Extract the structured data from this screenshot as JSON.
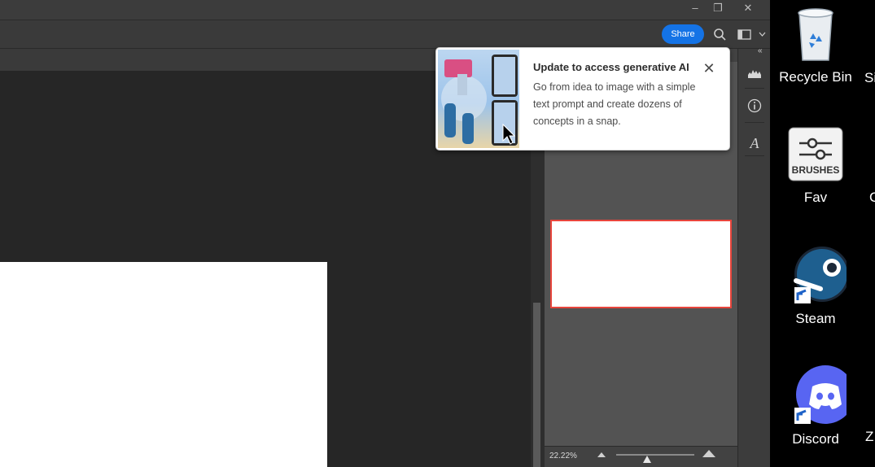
{
  "window": {
    "minimize_icon": "minimize-icon",
    "restore_icon": "restore-icon",
    "close_icon": "close-icon"
  },
  "toolbar": {
    "share_label": "Share"
  },
  "popup": {
    "title": "Update to access generative AI",
    "body": "Go from idea to image with a simple text prompt and create dozens of concepts in a snap.",
    "close_glyph": "✕"
  },
  "navigator": {
    "zoom": "22.22%",
    "zoom_level": 0.4
  },
  "desktop": {
    "icons": [
      {
        "label": "Recycle Bin"
      },
      {
        "label": "Fav"
      },
      {
        "label": "Steam"
      },
      {
        "label": "Discord"
      }
    ],
    "partial_labels": [
      "Si",
      "C",
      "Z"
    ]
  },
  "colors": {
    "accent": "#1473e6",
    "nav_frame": "#e8453c",
    "steam": "#1b2838",
    "discord": "#5865f2"
  }
}
